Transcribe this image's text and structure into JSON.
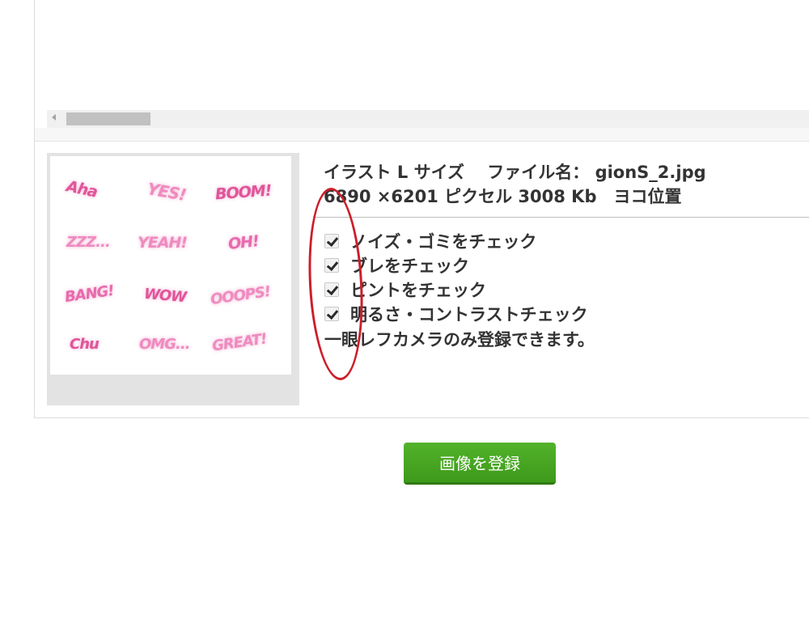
{
  "upload_panel": {
    "info_line1": "イラスト L サイズ　 ファイル名： gionS_2.jpg",
    "info_line2": "6890 ×6201 ピクセル 3008 Kb　ヨコ位置",
    "checks": [
      {
        "label": "ノイズ・ゴミをチェック",
        "checked": true
      },
      {
        "label": "ブレをチェック",
        "checked": true
      },
      {
        "label": "ピントをチェック",
        "checked": true
      },
      {
        "label": "明るさ・コントラストチェック",
        "checked": true
      }
    ],
    "note": "一眼レフカメラのみ登録できます。",
    "thumbnail_stickers": [
      "Aha",
      "YES!",
      "BOOM!",
      "ZZZ...",
      "YEAH!",
      "OH!",
      "BANG!",
      "WOW",
      "OOOPS!",
      "Chu",
      "OMG...",
      "GREAT!"
    ]
  },
  "submit": {
    "label": "画像を登録"
  },
  "colors": {
    "accent_green": "#4aa823",
    "annotation_red": "#cc1f2a",
    "sticker_pink": "#e0559a"
  }
}
